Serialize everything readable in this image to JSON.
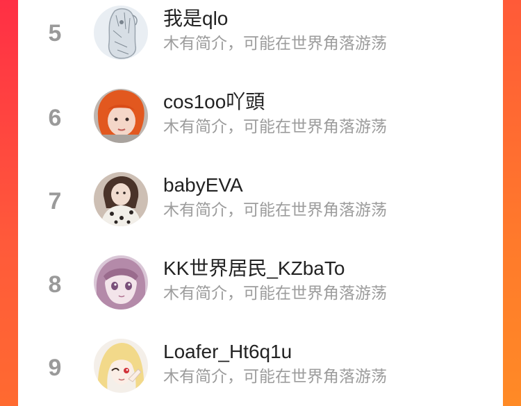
{
  "colors": {
    "accent_left": "#ff2f45",
    "accent_right": "#ff8a26",
    "rank": "#9a9a9a",
    "name": "#222222",
    "bio": "#9c9c9c"
  },
  "ranking": [
    {
      "rank": "5",
      "name": "我是qlo",
      "bio": "木有简介，可能在世界角落游荡",
      "avatar": "sketch-avatar"
    },
    {
      "rank": "6",
      "name": "cos1oo吖頭",
      "bio": "木有简介，可能在世界角落游荡",
      "avatar": "photo-avatar"
    },
    {
      "rank": "7",
      "name": "babyEVA",
      "bio": "木有简介，可能在世界角落游荡",
      "avatar": "photo-avatar"
    },
    {
      "rank": "8",
      "name": "KK世界居民_KZbaTo",
      "bio": "木有简介，可能在世界角落游荡",
      "avatar": "anime-avatar"
    },
    {
      "rank": "9",
      "name": "Loafer_Ht6q1u",
      "bio": "木有简介，可能在世界角落游荡",
      "avatar": "anime-avatar"
    }
  ]
}
